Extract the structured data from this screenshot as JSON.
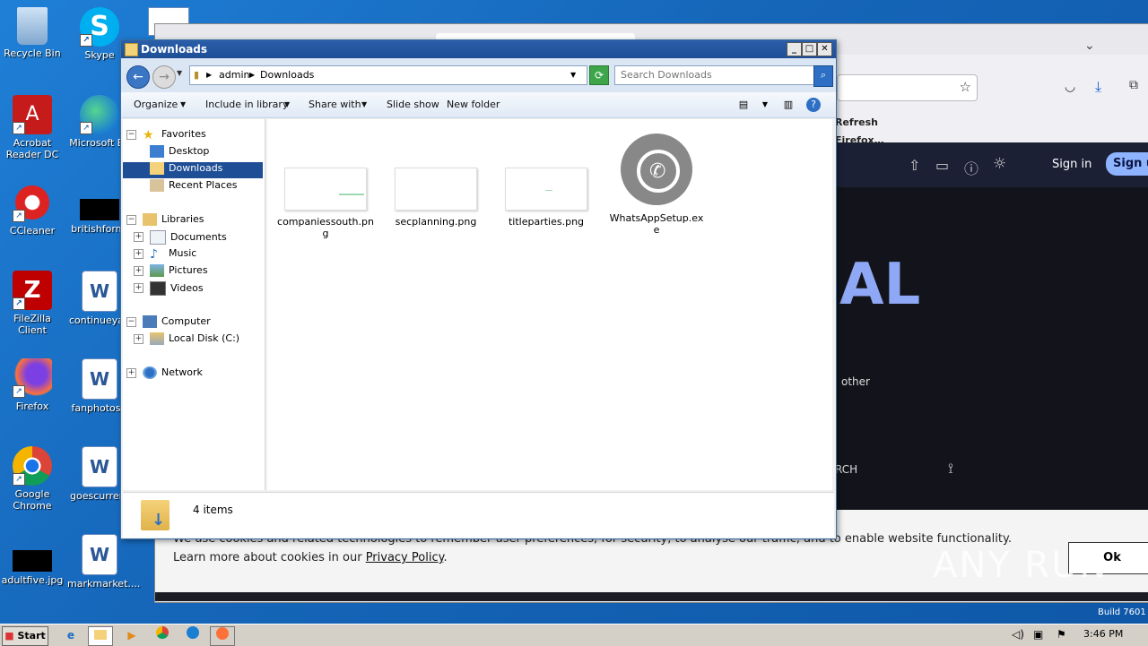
{
  "desktop": {
    "icons": [
      {
        "label": "Recycle Bin",
        "icon": "recycle-bin-icon"
      },
      {
        "label": "Skype",
        "icon": "skype-icon"
      },
      {
        "label": "Acrobat Reader DC",
        "icon": "acrobat-icon"
      },
      {
        "label": "Microsoft Ed",
        "icon": "edge-icon"
      },
      {
        "label": "CCleaner",
        "icon": "ccleaner-icon"
      },
      {
        "label": "britishform.",
        "icon": "black-file-icon"
      },
      {
        "label": "FileZilla Client",
        "icon": "filezilla-icon"
      },
      {
        "label": "continueyah",
        "icon": "word-doc-icon"
      },
      {
        "label": "Firefox",
        "icon": "firefox-icon"
      },
      {
        "label": "fanphotos.r",
        "icon": "word-doc-icon"
      },
      {
        "label": "Google Chrome",
        "icon": "chrome-icon"
      },
      {
        "label": "goescurrent",
        "icon": "word-doc-icon"
      },
      {
        "label": "adultfive.jpg",
        "icon": "black-file-icon"
      },
      {
        "label": "markmarket....",
        "icon": "word-doc-icon"
      }
    ]
  },
  "firefox": {
    "refresh_label": "Refresh Firefox…",
    "signin_label": "Sign in",
    "signup_label": "Sign u",
    "big_text": "AL",
    "other_text": "other",
    "rch_text": "RCH",
    "cookie_text": "We use cookies and related technologies to remember user preferences, for security, to analyse our traffic, and to enable website functionality. Learn more about cookies in our",
    "cookie_link": "Privacy Policy",
    "cookie_end": ".",
    "ok_label": "Ok",
    "watermark": "ANY RUN",
    "build": "Build 7601"
  },
  "explorer": {
    "title": "Downloads",
    "address": {
      "seg1": "admin",
      "seg2": "Downloads"
    },
    "search_placeholder": "Search Downloads",
    "toolbar": {
      "organize": "Organize",
      "include": "Include in library",
      "share": "Share with",
      "slideshow": "Slide show",
      "newfolder": "New folder"
    },
    "tree": {
      "favorites": "Favorites",
      "desktop": "Desktop",
      "downloads": "Downloads",
      "recent": "Recent Places",
      "libraries": "Libraries",
      "documents": "Documents",
      "music": "Music",
      "pictures": "Pictures",
      "videos": "Videos",
      "computer": "Computer",
      "localdisk": "Local Disk (C:)",
      "network": "Network"
    },
    "files": [
      {
        "name": "companiessouth.png",
        "icon": "png-thumbnail"
      },
      {
        "name": "secplanning.png",
        "icon": "png-thumbnail"
      },
      {
        "name": "titleparties.png",
        "icon": "png-thumbnail"
      },
      {
        "name": "WhatsAppSetup.exe",
        "icon": "whatsapp-icon"
      }
    ],
    "status": "4 items"
  },
  "taskbar": {
    "start_label": "Start",
    "clock": "3:46 PM"
  }
}
